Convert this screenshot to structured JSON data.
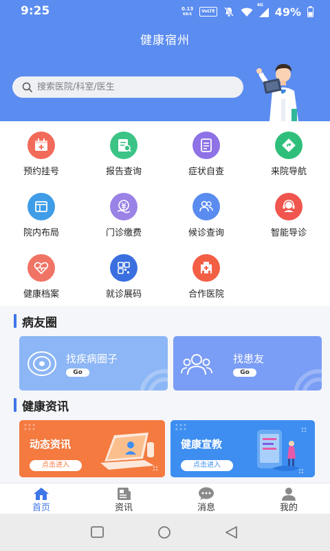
{
  "status_bar": {
    "time": "9:25",
    "net_speed_value": "0.13",
    "net_speed_unit": "KB/S",
    "volte": "VoLTE",
    "network": "4G",
    "battery": "49%"
  },
  "header": {
    "title": "健康宿州",
    "search_placeholder": "搜索医院/科室/医生"
  },
  "services": [
    {
      "label": "预约挂号",
      "color": "#f26a5a",
      "icon": "calendar-plus-icon"
    },
    {
      "label": "报告查询",
      "color": "#3cc486",
      "icon": "report-search-icon"
    },
    {
      "label": "症状自查",
      "color": "#8e72e6",
      "icon": "checklist-icon"
    },
    {
      "label": "来院导航",
      "color": "#2fbf7a",
      "icon": "navigation-icon"
    },
    {
      "label": "院内布局",
      "color": "#3f9de8",
      "icon": "layout-icon"
    },
    {
      "label": "门诊缴费",
      "color": "#9b82e6",
      "icon": "yuan-payment-icon"
    },
    {
      "label": "候诊查询",
      "color": "#5a8cf0",
      "icon": "people-queue-icon"
    },
    {
      "label": "智能导诊",
      "color": "#f0554e",
      "icon": "headset-icon"
    },
    {
      "label": "健康档案",
      "color": "#f07466",
      "icon": "heart-record-icon"
    },
    {
      "label": "就诊展码",
      "color": "#3a6fe0",
      "icon": "qr-code-icon"
    },
    {
      "label": "合作医院",
      "color": "#f25f45",
      "icon": "hospital-icon"
    }
  ],
  "patient_circle": {
    "title": "病友圈",
    "cards": [
      {
        "label": "找疾病圈子",
        "go": "Go",
        "color": "#8cb6f5"
      },
      {
        "label": "找患友",
        "go": "Go",
        "color": "#7a9df5"
      }
    ]
  },
  "health_news": {
    "title": "健康资讯",
    "cards": [
      {
        "label": "动态资讯",
        "button": "点击进入",
        "color": "#f47a40"
      },
      {
        "label": "健康宣教",
        "button": "点击进入",
        "color": "#3d8ef0"
      }
    ]
  },
  "tabs": [
    {
      "label": "首页",
      "icon": "home-icon",
      "active": true
    },
    {
      "label": "资讯",
      "icon": "news-icon",
      "active": false
    },
    {
      "label": "消息",
      "icon": "message-icon",
      "active": false
    },
    {
      "label": "我的",
      "icon": "user-icon",
      "active": false
    }
  ],
  "colors": {
    "header": "#5b8cf0",
    "accent": "#3f76e8"
  }
}
